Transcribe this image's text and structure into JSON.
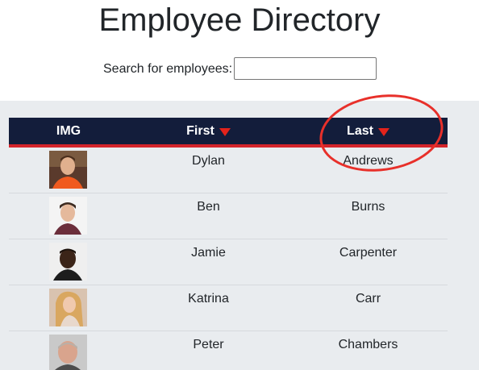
{
  "page": {
    "title": "Employee Directory"
  },
  "search": {
    "label": "Search for employees:",
    "value": "",
    "placeholder": ""
  },
  "table": {
    "columns": [
      {
        "label": "IMG",
        "sortable": false
      },
      {
        "label": "First",
        "sortable": true,
        "sort_icon": "triangle-down-icon"
      },
      {
        "label": "Last",
        "sortable": true,
        "sort_icon": "triangle-down-icon"
      }
    ],
    "rows": [
      {
        "first": "Dylan",
        "last": "Andrews",
        "avatar": "photo-dylan"
      },
      {
        "first": "Ben",
        "last": "Burns",
        "avatar": "photo-ben"
      },
      {
        "first": "Jamie",
        "last": "Carpenter",
        "avatar": "photo-jamie"
      },
      {
        "first": "Katrina",
        "last": "Carr",
        "avatar": "photo-katrina"
      },
      {
        "first": "Peter",
        "last": "Chambers",
        "avatar": "photo-peter"
      }
    ]
  },
  "colors": {
    "header_bg": "#131d3b",
    "header_border": "#d4242b",
    "sort_arrow": "#e4231b",
    "table_bg": "#e9ecef",
    "annotation": "#e8302a"
  }
}
